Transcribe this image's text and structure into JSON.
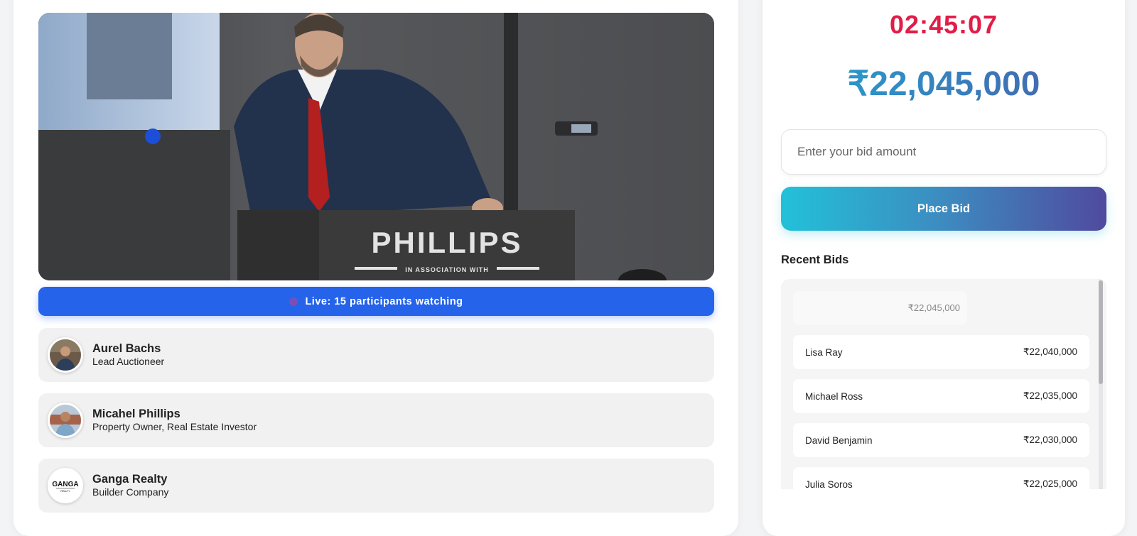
{
  "stream": {
    "podium_brand": "PHILLIPS",
    "podium_tagline": "IN ASSOCIATION WITH",
    "live_status": "Live: 15 participants watching"
  },
  "participants": [
    {
      "name": "Aurel Bachs",
      "role": "Lead Auctioneer",
      "avatar": "auctioneer-photo"
    },
    {
      "name": "Micahel Phillips",
      "role": "Property Owner, Real Estate Investor",
      "avatar": "owner-photo"
    },
    {
      "name": "Ganga Realty",
      "role": "Builder Company",
      "avatar": "ganga-realty-logo",
      "logo_text": "GANGA",
      "logo_subtext": "REALTY"
    }
  ],
  "auction": {
    "timer": "02:45:07",
    "current_price": "₹22,045,000",
    "bid_placeholder": "Enter your bid amount",
    "place_bid_label": "Place Bid"
  },
  "recent_bids": {
    "title": "Recent Bids",
    "latest_amount": "₹22,045,000",
    "items": [
      {
        "bidder": "Lisa Ray",
        "amount": "₹22,040,000"
      },
      {
        "bidder": "Michael Ross",
        "amount": "₹22,035,000"
      },
      {
        "bidder": "David Benjamin",
        "amount": "₹22,030,000"
      },
      {
        "bidder": "Julia Soros",
        "amount": "₹22,025,000"
      }
    ]
  },
  "colors": {
    "live_bar": "#2563eb",
    "timer": "#e11d48",
    "price_gradient_start": "#22a8d4",
    "price_gradient_end": "#4b5ba8",
    "button_gradient_start": "#22c1d9",
    "button_gradient_end": "#504a9e"
  }
}
